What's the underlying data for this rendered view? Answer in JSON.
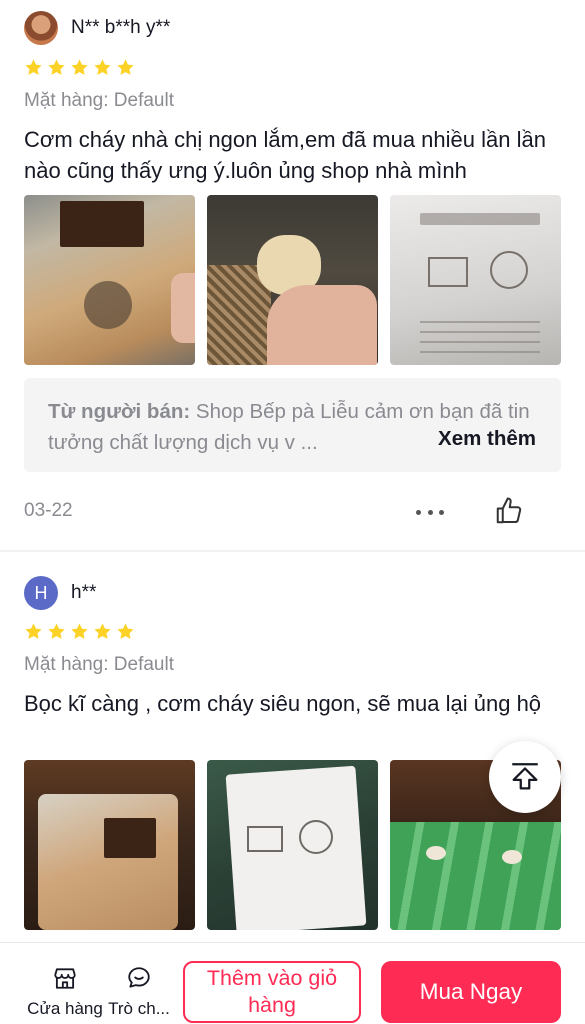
{
  "reviews": [
    {
      "username": "N** b**h y**",
      "avatar_letter": "",
      "rating": 5,
      "variant": "Mặt hàng: Default",
      "text": "Cơm cháy nhà chị ngon lắm,em đã mua nhiều lần lần nào cũng thấy ưng ý.luôn ủng shop nhà mình",
      "seller_reply": {
        "label": "Từ người bán:",
        "text": " Shop Bếp pà Liễu cảm ơn bạn đã tin tưởng chất lượng dịch vụ v ...",
        "see_more": "Xem thêm"
      },
      "date": "03-22"
    },
    {
      "username": "h**",
      "avatar_letter": "H",
      "rating": 5,
      "variant": "Mặt hàng: Default",
      "text": "Bọc kĩ càng , cơm cháy siêu ngon, sẽ mua lại ủng hộ"
    }
  ],
  "icons": {
    "star": "star-icon",
    "more": "more-horizontal-icon",
    "like": "thumbs-up-icon",
    "share": "share-icon",
    "shop": "store-icon",
    "chat": "chat-icon"
  },
  "bottom_bar": {
    "shop_label": "Cửa hàng",
    "chat_label": "Trò ch...",
    "add_to_cart_label": "Thêm vào giỏ hàng",
    "buy_now_label": "Mua Ngay"
  },
  "colors": {
    "accent": "#fe2c55",
    "star": "#fdd227",
    "muted_text": "#8a8b91",
    "seller_box_bg": "#f4f4f5",
    "avatar_letter_bg": "#5b6ac7"
  }
}
